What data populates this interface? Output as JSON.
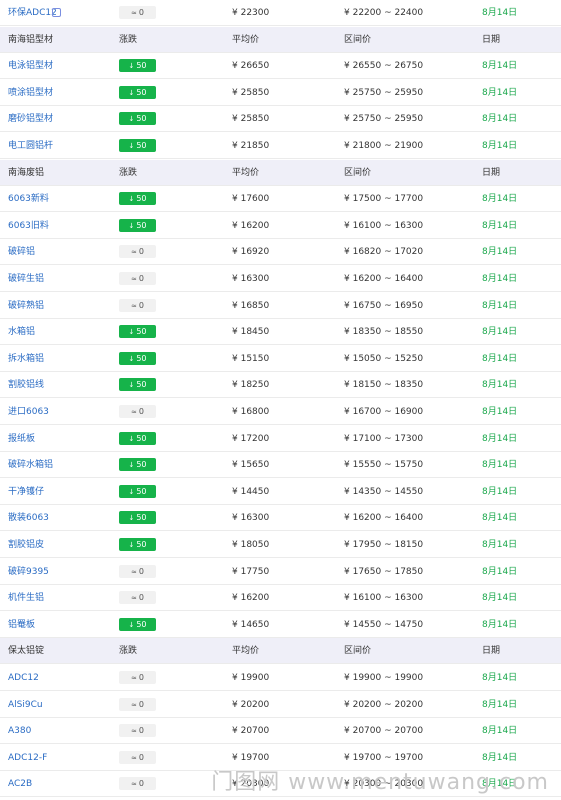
{
  "rows": [
    {
      "type": "item",
      "name": "环保ADC12",
      "change": "0",
      "dir": "flat",
      "avg": "¥ 22300",
      "range": "¥ 22200 ~ 22400",
      "date": "8月14日"
    },
    {
      "type": "header",
      "name": "南海铝型材",
      "change": "涨跌",
      "avg": "平均价",
      "range": "区间价",
      "date": "日期"
    },
    {
      "type": "item",
      "name": "电泳铝型材",
      "change": "50",
      "dir": "up",
      "avg": "¥ 26650",
      "range": "¥ 26550 ~ 26750",
      "date": "8月14日"
    },
    {
      "type": "item",
      "name": "喷涂铝型材",
      "change": "50",
      "dir": "up",
      "avg": "¥ 25850",
      "range": "¥ 25750 ~ 25950",
      "date": "8月14日"
    },
    {
      "type": "item",
      "name": "磨砂铝型材",
      "change": "50",
      "dir": "up",
      "avg": "¥ 25850",
      "range": "¥ 25750 ~ 25950",
      "date": "8月14日"
    },
    {
      "type": "item",
      "name": "电工圆铝杆",
      "change": "50",
      "dir": "up",
      "avg": "¥ 21850",
      "range": "¥ 21800 ~ 21900",
      "date": "8月14日"
    },
    {
      "type": "header",
      "name": "南海废铝",
      "change": "涨跌",
      "avg": "平均价",
      "range": "区间价",
      "date": "日期"
    },
    {
      "type": "item",
      "name": "6063新料",
      "change": "50",
      "dir": "up",
      "avg": "¥ 17600",
      "range": "¥ 17500 ~ 17700",
      "date": "8月14日"
    },
    {
      "type": "item",
      "name": "6063旧料",
      "change": "50",
      "dir": "up",
      "avg": "¥ 16200",
      "range": "¥ 16100 ~ 16300",
      "date": "8月14日"
    },
    {
      "type": "item",
      "name": "破碎铝",
      "change": "0",
      "dir": "flat",
      "avg": "¥ 16920",
      "range": "¥ 16820 ~ 17020",
      "date": "8月14日"
    },
    {
      "type": "item",
      "name": "破碎生铝",
      "change": "0",
      "dir": "flat",
      "avg": "¥ 16300",
      "range": "¥ 16200 ~ 16400",
      "date": "8月14日"
    },
    {
      "type": "item",
      "name": "破碎熟铝",
      "change": "0",
      "dir": "flat",
      "avg": "¥ 16850",
      "range": "¥ 16750 ~ 16950",
      "date": "8月14日"
    },
    {
      "type": "item",
      "name": "水箱铝",
      "change": "50",
      "dir": "up",
      "avg": "¥ 18450",
      "range": "¥ 18350 ~ 18550",
      "date": "8月14日"
    },
    {
      "type": "item",
      "name": "拆水箱铝",
      "change": "50",
      "dir": "up",
      "avg": "¥ 15150",
      "range": "¥ 15050 ~ 15250",
      "date": "8月14日"
    },
    {
      "type": "item",
      "name": "割胶铝线",
      "change": "50",
      "dir": "up",
      "avg": "¥ 18250",
      "range": "¥ 18150 ~ 18350",
      "date": "8月14日"
    },
    {
      "type": "item",
      "name": "进口6063",
      "change": "0",
      "dir": "flat",
      "avg": "¥ 16800",
      "range": "¥ 16700 ~ 16900",
      "date": "8月14日"
    },
    {
      "type": "item",
      "name": "报纸板",
      "change": "50",
      "dir": "up",
      "avg": "¥ 17200",
      "range": "¥ 17100 ~ 17300",
      "date": "8月14日"
    },
    {
      "type": "item",
      "name": "破碎水箱铝",
      "change": "50",
      "dir": "up",
      "avg": "¥ 15650",
      "range": "¥ 15550 ~ 15750",
      "date": "8月14日"
    },
    {
      "type": "item",
      "name": "干净镬仔",
      "change": "50",
      "dir": "up",
      "avg": "¥ 14450",
      "range": "¥ 14350 ~ 14550",
      "date": "8月14日"
    },
    {
      "type": "item",
      "name": "散装6063",
      "change": "50",
      "dir": "up",
      "avg": "¥ 16300",
      "range": "¥ 16200 ~ 16400",
      "date": "8月14日"
    },
    {
      "type": "item",
      "name": "割胶铝皮",
      "change": "50",
      "dir": "up",
      "avg": "¥ 18050",
      "range": "¥ 17950 ~ 18150",
      "date": "8月14日"
    },
    {
      "type": "item",
      "name": "破碎9395",
      "change": "0",
      "dir": "flat",
      "avg": "¥ 17750",
      "range": "¥ 17650 ~ 17850",
      "date": "8月14日"
    },
    {
      "type": "item",
      "name": "机件生铝",
      "change": "0",
      "dir": "flat",
      "avg": "¥ 16200",
      "range": "¥ 16100 ~ 16300",
      "date": "8月14日"
    },
    {
      "type": "item",
      "name": "铝罨板",
      "change": "50",
      "dir": "up",
      "avg": "¥ 14650",
      "range": "¥ 14550 ~ 14750",
      "date": "8月14日"
    },
    {
      "type": "header",
      "name": "保太铝锭",
      "change": "涨跌",
      "avg": "平均价",
      "range": "区间价",
      "date": "日期"
    },
    {
      "type": "item",
      "name": "ADC12",
      "change": "0",
      "dir": "flat",
      "avg": "¥ 19900",
      "range": "¥ 19900 ~ 19900",
      "date": "8月14日"
    },
    {
      "type": "item",
      "name": "AlSi9Cu",
      "change": "0",
      "dir": "flat",
      "avg": "¥ 20200",
      "range": "¥ 20200 ~ 20200",
      "date": "8月14日"
    },
    {
      "type": "item",
      "name": "A380",
      "change": "0",
      "dir": "flat",
      "avg": "¥ 20700",
      "range": "¥ 20700 ~ 20700",
      "date": "8月14日"
    },
    {
      "type": "item",
      "name": "ADC12-F",
      "change": "0",
      "dir": "flat",
      "avg": "¥ 19700",
      "range": "¥ 19700 ~ 19700",
      "date": "8月14日"
    },
    {
      "type": "item",
      "name": "AC2B",
      "change": "0",
      "dir": "flat",
      "avg": "¥ 20300",
      "range": "¥ 20300 ~ 20300",
      "date": "8月14日"
    }
  ],
  "watermark": "门图网 www.mentuwang.com",
  "colors": {
    "up": "#16b34a",
    "header_bg": "#efeff8",
    "link": "#2b6cc4",
    "date": "#19a74b"
  }
}
